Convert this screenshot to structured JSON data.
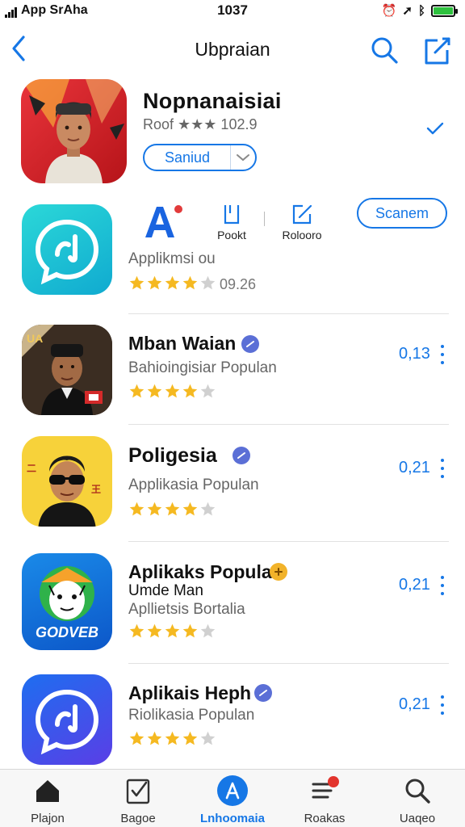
{
  "status": {
    "carrier": "App SrAha",
    "time": "1037",
    "battery_color": "#2ec13e"
  },
  "nav": {
    "title": "Ubpraian"
  },
  "featured": {
    "title": "Nopnanaisiai",
    "rating_text": "Roof ★★★ 102.9",
    "button_label": "Saniud"
  },
  "actions": {
    "font_label": "Pookt",
    "edit_label": "Rolooro",
    "scan_label": "Scanem"
  },
  "apps": [
    {
      "subtitle": "Applikmsi ou",
      "rating": 4,
      "rating_count": "09.26"
    },
    {
      "title": "Mban Waian",
      "subtitle": "Bahioingisiar Populan",
      "rating": 4,
      "price": "0,13"
    },
    {
      "title": "Poligesia",
      "subtitle": "Applikasia Populan",
      "rating": 4,
      "price": "0,21"
    },
    {
      "title": "Aplikaks Popula",
      "developer": "Umde Man",
      "subtitle": "Apllietsis Bortalia",
      "rating": 4,
      "price": "0,21",
      "icon_text": "GODVEB"
    },
    {
      "title": "Aplikais Heph",
      "subtitle": "Riolikasia Populan",
      "rating": 4,
      "price": "0,21"
    }
  ],
  "tabs": [
    {
      "label": "Plajon"
    },
    {
      "label": "Bagoe"
    },
    {
      "label": "Lnhoomaia"
    },
    {
      "label": "Roakas"
    },
    {
      "label": "Uaqeo"
    }
  ],
  "colors": {
    "accent": "#1677e6",
    "star": "#f5b921",
    "star_empty": "#d0d0d0"
  }
}
